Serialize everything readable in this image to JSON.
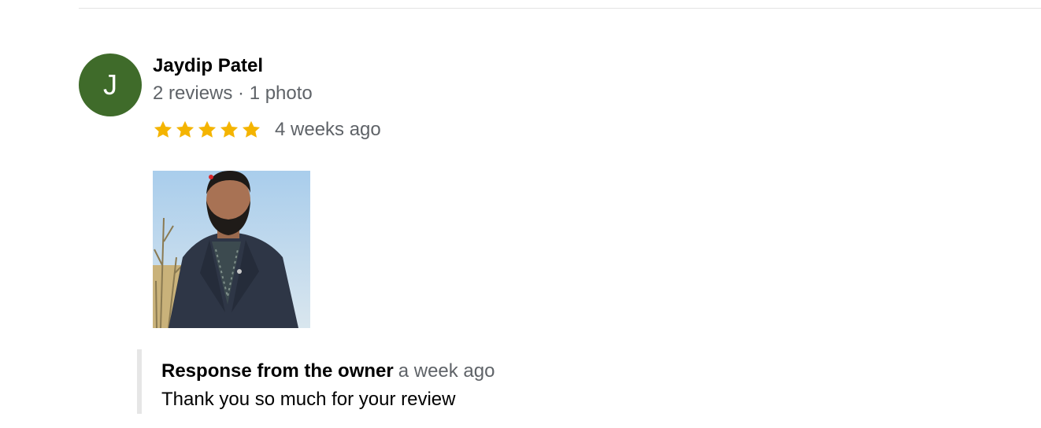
{
  "colors": {
    "avatar_bg": "#3f6b2a",
    "star": "#f4b400",
    "divider": "#e3e3e3"
  },
  "review": {
    "reviewer": {
      "avatar_letter": "J",
      "name": "Jaydip Patel",
      "meta": "2 reviews · 1 photo"
    },
    "rating": {
      "stars": 5,
      "max": 5,
      "icon": "star-icon"
    },
    "time": "4 weeks ago",
    "photo": {
      "icon": "review-photo"
    },
    "owner_response": {
      "title": "Response from the owner",
      "time": "a week ago",
      "text": "Thank you so much for your review"
    }
  }
}
